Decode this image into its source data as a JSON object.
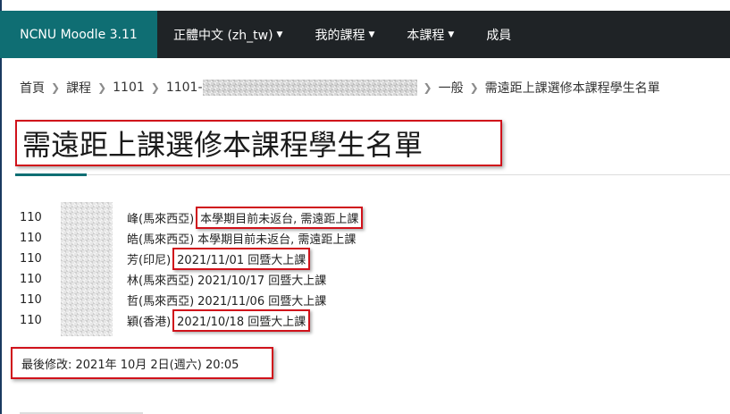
{
  "navbar": {
    "brand": "NCNU Moodle 3.11",
    "items": [
      {
        "label": "正體中文 (zh_tw)",
        "dropdown": true
      },
      {
        "label": "我的課程",
        "dropdown": true
      },
      {
        "label": "本課程",
        "dropdown": true
      },
      {
        "label": "成員",
        "dropdown": false
      }
    ]
  },
  "breadcrumb": {
    "items": [
      "首頁",
      "課程",
      "1101",
      "1101-",
      "一般",
      "需遠距上課選修本課程學生名單"
    ]
  },
  "page": {
    "title": "需遠距上課選修本課程學生名單"
  },
  "students": [
    {
      "id": "110",
      "name": "峰(馬來西亞)",
      "note": "本學期目前未返台, 需遠距上課",
      "highlight": true
    },
    {
      "id": "110",
      "name": "皓(馬來西亞)",
      "note": "本學期目前未返台, 需遠距上課",
      "highlight": false
    },
    {
      "id": "110",
      "name": "芳(印尼)",
      "note": "2021/11/01 回暨大上課",
      "highlight": true
    },
    {
      "id": "110",
      "name": "林(馬來西亞)",
      "note": "2021/10/17 回暨大上課",
      "highlight": false
    },
    {
      "id": "110",
      "name": "哲(馬來西亞)",
      "note": "2021/11/06 回暨大上課",
      "highlight": false
    },
    {
      "id": "110",
      "name": "穎(香港)",
      "note": "2021/10/18 回暨大上課",
      "highlight": true
    }
  ],
  "footer": {
    "last_modified": "最後修改: 2021年 10月 2日(週六) 20:05"
  },
  "colors": {
    "brand_bg": "#0f6e73",
    "navbar_bg": "#1f2326",
    "highlight": "#d0121b"
  }
}
